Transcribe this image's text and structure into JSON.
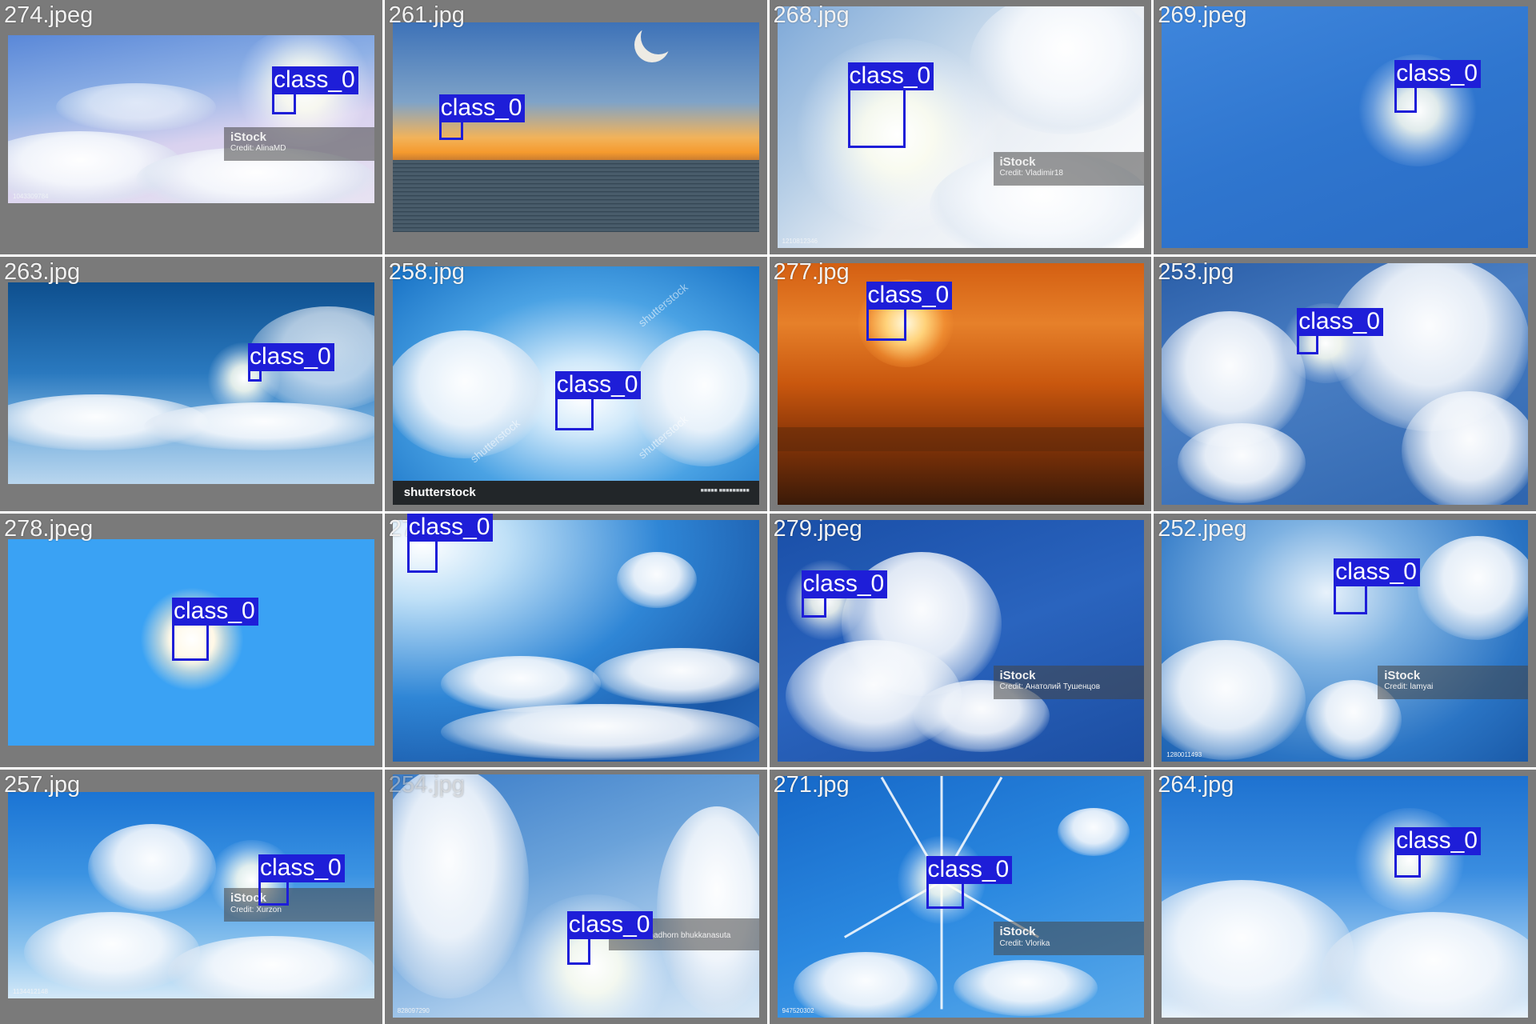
{
  "box_label": "class_0",
  "colors": {
    "box": "#1e1ed8",
    "tile_background": "#7a7a7a"
  },
  "tiles": [
    {
      "filename": "274.jpeg",
      "watermark_brand": "iStock",
      "watermark_credit": "Credit: AlinaMD",
      "image_id": "1043309784"
    },
    {
      "filename": "261.jpg"
    },
    {
      "filename": "268.jpg",
      "watermark_brand": "iStock",
      "watermark_credit": "Credit: Vladimir18",
      "image_id": "1210812346"
    },
    {
      "filename": "269.jpeg"
    },
    {
      "filename": "263.jpg"
    },
    {
      "filename": "258.jpg",
      "stock_brand": "shutterstock",
      "stock_mark": "shutterstock"
    },
    {
      "filename": "277.jpg"
    },
    {
      "filename": "253.jpg"
    },
    {
      "filename": "278.jpeg"
    },
    {
      "filename": "27"
    },
    {
      "filename": "279.jpeg",
      "watermark_brand": "iStock",
      "watermark_credit": "Credit: Анатолий Тушенцов"
    },
    {
      "filename": "252.jpeg",
      "watermark_brand": "iStock",
      "watermark_credit": "Credit: lamyai",
      "image_id": "1280011493"
    },
    {
      "filename": "257.jpg",
      "watermark_brand": "iStock",
      "watermark_credit": "Credit: Xurzon",
      "image_id": "1134412148"
    },
    {
      "filename": "254.jpg",
      "watermark_credit": "Credit: yanadhorn bhukkanasuta",
      "image_id": "828097290"
    },
    {
      "filename": "271.jpg",
      "watermark_brand": "iStock",
      "watermark_credit": "Credit: Vlorika",
      "image_id": "947520302"
    },
    {
      "filename": "264.jpg"
    }
  ]
}
